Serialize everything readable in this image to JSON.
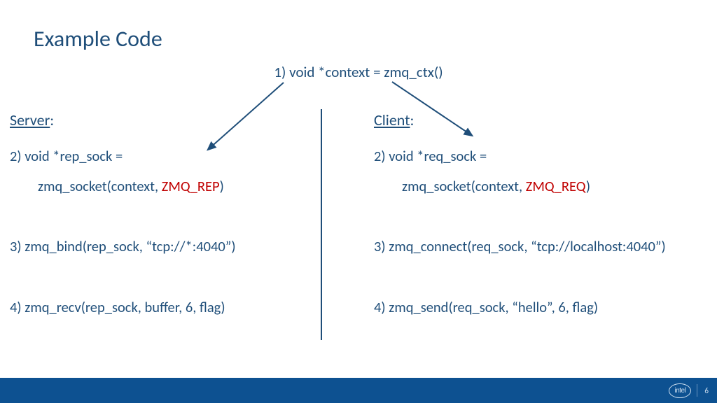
{
  "title": "Example Code",
  "context_line": "1) void *context = zmq_ctx()",
  "server": {
    "header": "Server",
    "colon": ":",
    "step2_a": "2) void *rep_sock =",
    "step2_b_pre": "zmq_socket(context, ",
    "step2_b_red": "ZMQ_REP",
    "step2_b_post": ")",
    "step3": "3) zmq_bind(rep_sock, “tcp://*:4040”)",
    "step4": "4) zmq_recv(rep_sock, buffer, 6, flag)"
  },
  "client": {
    "header": "Client",
    "colon": ":",
    "step2_a": "2) void *req_sock =",
    "step2_b_pre": "zmq_socket(context, ",
    "step2_b_red": "ZMQ_REQ",
    "step2_b_post": ")",
    "step3": "3) zmq_connect(req_sock, “tcp://localhost:4040”)",
    "step4": "4) zmq_send(req_sock, “hello”, 6, flag)"
  },
  "footer": {
    "logo_text": "intel",
    "page_number": "6"
  },
  "colors": {
    "primary": "#1f4e79",
    "accent_red": "#C00000",
    "footer_bg": "#0d5191"
  }
}
